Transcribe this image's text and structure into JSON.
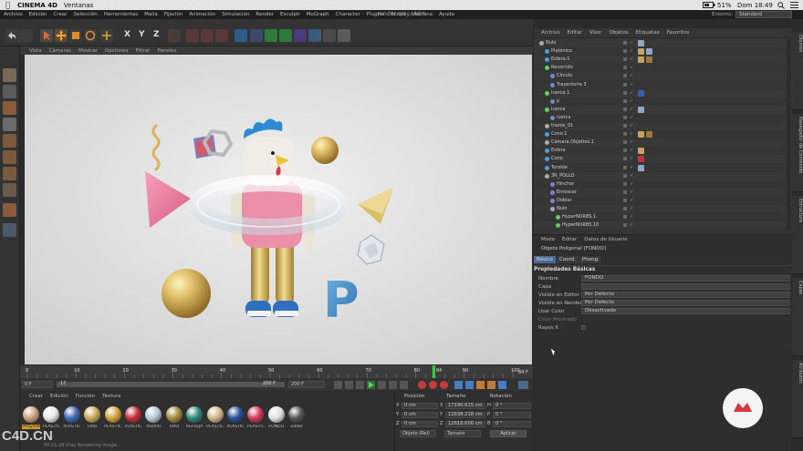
{
  "mac_menubar": {
    "app_name": "CINEMA 4D",
    "menu": "Ventanas",
    "status": {
      "battery": "51%",
      "time": "Dom 18:49"
    }
  },
  "document_title": "render vray.c4d *",
  "app_menu": [
    "Archivo",
    "Edición",
    "Crear",
    "Selección",
    "Herramientas",
    "Malla",
    "Fijación",
    "Animación",
    "Simulación",
    "Render",
    "Esculpir",
    "MoGraph",
    "Character",
    "Plugins",
    "Script",
    "Ventana",
    "Ayuda"
  ],
  "layout": {
    "label": "Entorno:",
    "value": "Standard"
  },
  "toolbar": {
    "axis_labels": [
      "X",
      "Y",
      "Z"
    ]
  },
  "viewport": {
    "menu": [
      "Vista",
      "Cámaras",
      "Mostrar",
      "Opciones",
      "Filtrar",
      "Paneles"
    ],
    "letter_prop": "P"
  },
  "timeline": {
    "ticks": [
      "0",
      "10",
      "20",
      "30",
      "40",
      "50",
      "60",
      "70",
      "80",
      "84",
      "90",
      "100"
    ],
    "current_frame_marker": "84",
    "end_label": "84 F",
    "controls": {
      "start": "0 F",
      "current": "17",
      "end": "200 F",
      "max": "200 F"
    }
  },
  "material_manager": {
    "menu": [
      "Crear",
      "Edición",
      "Función",
      "Textura"
    ],
    "materials": [
      {
        "label": "VRayAdv",
        "color": "#c9a27a"
      },
      {
        "label": "PLÁSTIC",
        "color": "#e8e8ea"
      },
      {
        "label": "PLÁSTIC",
        "color": "#3f68b8"
      },
      {
        "label": "ORO",
        "color": "#c9a85a"
      },
      {
        "label": "PLÁSTIC",
        "color": "#d6a23c"
      },
      {
        "label": "PLÁSTIC",
        "color": "#c62f3c"
      },
      {
        "label": "VIDRIO",
        "color": "#b7c9d8"
      },
      {
        "label": "ORO",
        "color": "#9f8a3b"
      },
      {
        "label": "REFLEJA",
        "color": "#2e8a78"
      },
      {
        "label": "PLÁSTIC",
        "color": "#d1b48a"
      },
      {
        "label": "PLÁSTIC",
        "color": "#2c4f9a"
      },
      {
        "label": "PLÁSTIC",
        "color": "#d6395a"
      },
      {
        "label": "FONDO",
        "color": "#e0e0e0"
      },
      {
        "label": "Editor",
        "color": "#555555"
      }
    ]
  },
  "coordinates": {
    "headers": [
      "Posición",
      "Tamaño",
      "Rotación"
    ],
    "rows": [
      {
        "axis": "X",
        "pos": "0 cm",
        "size_axis": "X",
        "size": "17190.615 cm",
        "rot_axis": "H",
        "rot": "0 °"
      },
      {
        "axis": "Y",
        "pos": "0 cm",
        "size_axis": "Y",
        "size": "12638.218 cm",
        "rot_axis": "P",
        "rot": "0 °"
      },
      {
        "axis": "Z",
        "pos": "0 cm",
        "size_axis": "Z",
        "size": "12618.606 cm",
        "rot_axis": "B",
        "rot": "0 °"
      }
    ],
    "mode": "Objeto (Rel)",
    "size_mode": "Tamaño",
    "apply_label": "Aplicar"
  },
  "status_bar": "00:11:29 Vray Rendering image...",
  "watermark": "C4D.CN",
  "object_manager": {
    "menu": [
      "Archivo",
      "Editar",
      "Visor",
      "Objetos",
      "Etiquetas",
      "Favoritos"
    ],
    "objects": [
      {
        "name": "Nulo",
        "indent": 0,
        "color": "#aaaaaa",
        "tags": [
          "#8fa6c6"
        ]
      },
      {
        "name": "Platónico",
        "indent": 1,
        "color": "#4aa0e0",
        "tags": [
          "#c8a060",
          "#8fa6c6"
        ]
      },
      {
        "name": "Esfera.1",
        "indent": 1,
        "color": "#4aa0e0",
        "tags": [
          "#c8a060",
          "#9a7a40"
        ]
      },
      {
        "name": "Recorrido",
        "indent": 1,
        "color": "#5ccf5c",
        "tags": []
      },
      {
        "name": "Círculo",
        "indent": 2,
        "color": "#6a8ad0",
        "tags": []
      },
      {
        "name": "Trayectoria 3",
        "indent": 2,
        "color": "#6a8ad0",
        "tags": []
      },
      {
        "name": "Iuerca.1",
        "indent": 1,
        "color": "#5ccf5c",
        "tags": [
          "#3a5fb0"
        ]
      },
      {
        "name": "p",
        "indent": 2,
        "color": "#6a8ad0",
        "tags": []
      },
      {
        "name": "Iuerca",
        "indent": 1,
        "color": "#5ccf5c",
        "tags": [
          "#8fa6c6"
        ]
      },
      {
        "name": "Iuerca",
        "indent": 2,
        "color": "#6a8ad0",
        "tags": []
      },
      {
        "name": "trazos_01",
        "indent": 1,
        "color": "#aaaaaa",
        "tags": []
      },
      {
        "name": "Cono.1",
        "indent": 1,
        "color": "#4aa0e0",
        "tags": [
          "#c8a060",
          "#9a7a40"
        ]
      },
      {
        "name": "Cámara.Objetivo.1",
        "indent": 1,
        "color": "#aaaaaa",
        "tags": []
      },
      {
        "name": "Esfera",
        "indent": 1,
        "color": "#4aa0e0",
        "tags": [
          "#c8a060"
        ]
      },
      {
        "name": "Cono",
        "indent": 1,
        "color": "#4aa0e0",
        "tags": [
          "#c62f3c"
        ]
      },
      {
        "name": "Toroide",
        "indent": 1,
        "color": "#4aa0e0",
        "tags": [
          "#8fa6c6"
        ]
      },
      {
        "name": "3R_POLLO",
        "indent": 1,
        "color": "#aaaaaa",
        "tags": []
      },
      {
        "name": "Hinchar",
        "indent": 2,
        "color": "#8a7ad8",
        "tags": []
      },
      {
        "name": "Enroscar",
        "indent": 2,
        "color": "#8a7ad8",
        "tags": []
      },
      {
        "name": "Doblar",
        "indent": 2,
        "color": "#8a7ad8",
        "tags": []
      },
      {
        "name": "Nulo",
        "indent": 2,
        "color": "#aaaaaa",
        "tags": []
      },
      {
        "name": "HyperNURBS.1",
        "indent": 3,
        "color": "#5ccf5c",
        "tags": []
      },
      {
        "name": "HyperNURBS.10",
        "indent": 3,
        "color": "#5ccf5c",
        "tags": []
      }
    ]
  },
  "attribute_manager": {
    "menu": [
      "Modo",
      "Editar",
      "Datos de Usuario"
    ],
    "object_title": "Objeto Poligonal [FONDO]",
    "tabs": [
      "Básico",
      "Coord.",
      "Phong"
    ],
    "section": "Propiedades Básicas",
    "fields": [
      {
        "label": "Nombre",
        "value": "FONDO"
      },
      {
        "label": "Capa",
        "value": ""
      },
      {
        "label": "Visible en Editor",
        "value": "Por Defecto"
      },
      {
        "label": "Visible en Render",
        "value": "Por Defecto"
      },
      {
        "label": "Usar Color",
        "value": "Desactivado"
      },
      {
        "label": "Color Mostrado",
        "value": ""
      },
      {
        "label": "Rayos X",
        "value": ""
      }
    ]
  },
  "right_tabs": [
    "Objetos",
    "Navegador de Contenido",
    "Estructura",
    "Capas",
    "Atributos"
  ]
}
